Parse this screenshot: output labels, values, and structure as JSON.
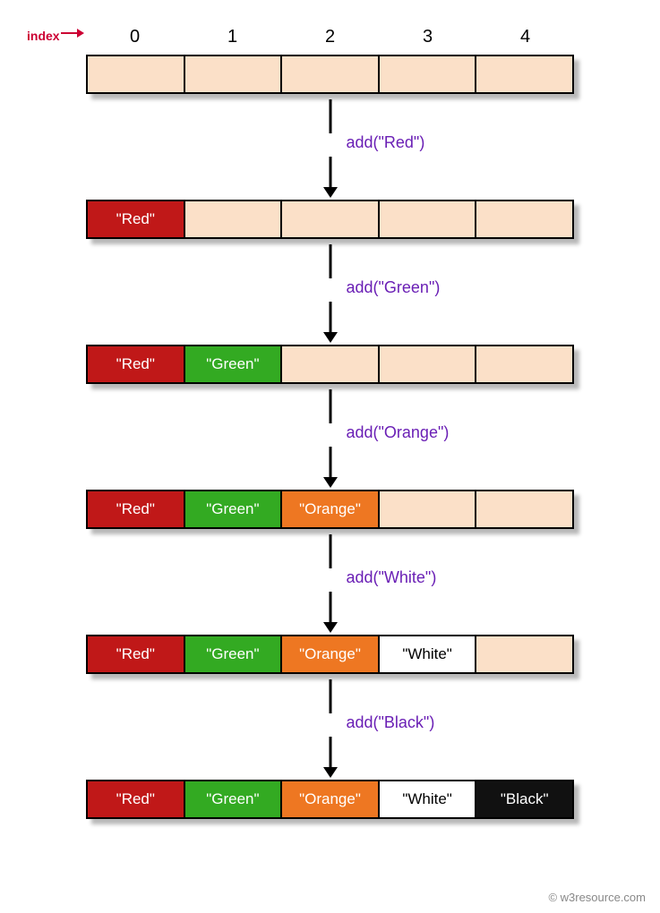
{
  "indexLabel": "index",
  "indices": [
    "0",
    "1",
    "2",
    "3",
    "4"
  ],
  "colors": {
    "red": "#c01818",
    "green": "#33aa22",
    "orange": "#ee7722",
    "white": "#ffffff",
    "black": "#111111",
    "empty": "#fbe0c8",
    "operation": "#6a1fb5",
    "indexLabel": "#cc0033"
  },
  "arrays": [
    {
      "cells": [
        {
          "text": "",
          "cls": "empty"
        },
        {
          "text": "",
          "cls": "empty"
        },
        {
          "text": "",
          "cls": "empty"
        },
        {
          "text": "",
          "cls": "empty"
        },
        {
          "text": "",
          "cls": "empty"
        }
      ]
    },
    {
      "cells": [
        {
          "text": "\"Red\"",
          "cls": "red"
        },
        {
          "text": "",
          "cls": "empty"
        },
        {
          "text": "",
          "cls": "empty"
        },
        {
          "text": "",
          "cls": "empty"
        },
        {
          "text": "",
          "cls": "empty"
        }
      ]
    },
    {
      "cells": [
        {
          "text": "\"Red\"",
          "cls": "red"
        },
        {
          "text": "\"Green\"",
          "cls": "green"
        },
        {
          "text": "",
          "cls": "empty"
        },
        {
          "text": "",
          "cls": "empty"
        },
        {
          "text": "",
          "cls": "empty"
        }
      ]
    },
    {
      "cells": [
        {
          "text": "\"Red\"",
          "cls": "red"
        },
        {
          "text": "\"Green\"",
          "cls": "green"
        },
        {
          "text": "\"Orange\"",
          "cls": "orange"
        },
        {
          "text": "",
          "cls": "empty"
        },
        {
          "text": "",
          "cls": "empty"
        }
      ]
    },
    {
      "cells": [
        {
          "text": "\"Red\"",
          "cls": "red"
        },
        {
          "text": "\"Green\"",
          "cls": "green"
        },
        {
          "text": "\"Orange\"",
          "cls": "orange"
        },
        {
          "text": "\"White\"",
          "cls": "white"
        },
        {
          "text": "",
          "cls": "empty"
        }
      ]
    },
    {
      "cells": [
        {
          "text": "\"Red\"",
          "cls": "red"
        },
        {
          "text": "\"Green\"",
          "cls": "green"
        },
        {
          "text": "\"Orange\"",
          "cls": "orange"
        },
        {
          "text": "\"White\"",
          "cls": "white"
        },
        {
          "text": "\"Black\"",
          "cls": "black"
        }
      ]
    }
  ],
  "operations": [
    "add(\"Red\")",
    "add(\"Green\")",
    "add(\"Orange\")",
    "add(\"White\")",
    "add(\"Black\")"
  ],
  "credit": "© w3resource.com"
}
